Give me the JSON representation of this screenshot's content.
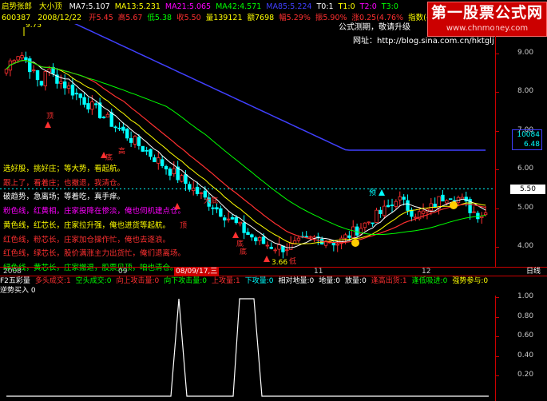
{
  "header": {
    "title": "启势张郎",
    "title2": "大小顶",
    "ma_items": [
      {
        "label": "MA7:5.107",
        "color": "#ffffff"
      },
      {
        "label": "MA13:5.231",
        "color": "#ffff00"
      },
      {
        "label": "MA21:5.065",
        "color": "#ff00ff"
      },
      {
        "label": "MA42:4.571",
        "color": "#00ff00"
      },
      {
        "label": "MA85:5.224",
        "color": "#4040ff"
      },
      {
        "label": "T0:1",
        "color": "#ffffff"
      },
      {
        "label": "T1:0",
        "color": "#ffff00"
      },
      {
        "label": "T2:0",
        "color": "#ff00ff"
      },
      {
        "label": "T3:0",
        "color": "#00ff00"
      }
    ],
    "code": "600387",
    "date": "2008/12/22",
    "quote_items": [
      {
        "label": "开5.45",
        "color": "#ff3030"
      },
      {
        "label": "高5.67",
        "color": "#ff3030"
      },
      {
        "label": "低5.38",
        "color": "#00ff00"
      },
      {
        "label": "收5.50",
        "color": "#ff3030"
      },
      {
        "label": "量139121",
        "color": "#ffff00"
      },
      {
        "label": "额7698",
        "color": "#ffff00"
      },
      {
        "label": "幅5.29%",
        "color": "#ff3030"
      },
      {
        "label": "振5.90%",
        "color": "#ff3030"
      },
      {
        "label": "涨0.25(4.76%",
        "color": "#ff3030"
      },
      {
        "label": "指数(-1",
        "color": "#ffff00"
      }
    ]
  },
  "watermark": {
    "line1": "第一股票公式网",
    "line2": "www.chnmoney.com"
  },
  "blog": {
    "line1": "公式测期，敬请升级",
    "line2": "网址：http://blog.sina.com.cn/hktglj"
  },
  "price_axis": {
    "ticks": [
      "9.00",
      "8.00",
      "7.00",
      "6.00",
      "5.00",
      "4.00"
    ],
    "current_price": "5.50",
    "highlight_top": "10084",
    "highlight_bottom": "6.48"
  },
  "annotations": {
    "high_label": "9.75",
    "low_label": "3.66",
    "date_marker": "08/09/17,三",
    "cursor_label": "预",
    "labels": [
      "顶",
      "高",
      "底",
      "大底",
      "顶",
      "底",
      "底",
      "低"
    ]
  },
  "legend": [
    {
      "text": "选好股，挑好庄；等大势，看起航。",
      "color": "#ffff00"
    },
    {
      "text": "跟上了，看着庄；也撤退，我清仓。",
      "color": "#ff3030"
    },
    {
      "text": "破趋势，急离场；等着吃，真手痒。",
      "color": "#ffffff"
    },
    {
      "text": "粉色线，红黄相，庄家投降在惨淡，俺也伺机建点仓。",
      "color": "#ff00ff"
    },
    {
      "text": "黄色线，红芯长，庄家拉升强，俺也进货等起航。",
      "color": "#ffff00"
    },
    {
      "text": "红色线，粉芯长，庄家加仓操作忙，俺也去逐浪。",
      "color": "#ff3030"
    },
    {
      "text": "红色线，绿芯长，股价满涨主力出货忙，俺们退离场。",
      "color": "#ff3030"
    },
    {
      "text": "绿色线，黄芯长，庄家撤退，股票见顶，咱也清仓。",
      "color": "#00ff00"
    }
  ],
  "date_bar": {
    "labels": [
      "2008",
      "09",
      "08/09/17,三",
      "11",
      "12"
    ],
    "right_label": "日线"
  },
  "sub_panel": {
    "title_items": [
      {
        "label": "F2五彩量",
        "color": "#ffffff"
      },
      {
        "label": "多头成交:1",
        "color": "#ff3030"
      },
      {
        "label": "空头成交:0",
        "color": "#00ff00"
      },
      {
        "label": "向上攻击量:0",
        "color": "#ff3030"
      },
      {
        "label": "向下攻击量:0",
        "color": "#00ff00"
      },
      {
        "label": "上攻量:1",
        "color": "#ff3030"
      },
      {
        "label": "下攻量:0",
        "color": "#00ffff"
      },
      {
        "label": "相对地量:0",
        "color": "#ffffff"
      },
      {
        "label": "地量:0",
        "color": "#ffffff"
      },
      {
        "label": "放量:0",
        "color": "#ffffff"
      },
      {
        "label": "逢高出货:1",
        "color": "#ff3030"
      },
      {
        "label": "逢低吸进:0",
        "color": "#00ff00"
      },
      {
        "label": "强势参与:0",
        "color": "#ffff00"
      }
    ],
    "title2": "逆势买入",
    "title2_value": "0",
    "axis_ticks": [
      "1.00",
      "0.80",
      "0.60",
      "0.40",
      "0.20"
    ]
  },
  "colors": {
    "border": "#cc0000",
    "up": "#ff3030",
    "down": "#00ffff",
    "bg": "#000000"
  }
}
